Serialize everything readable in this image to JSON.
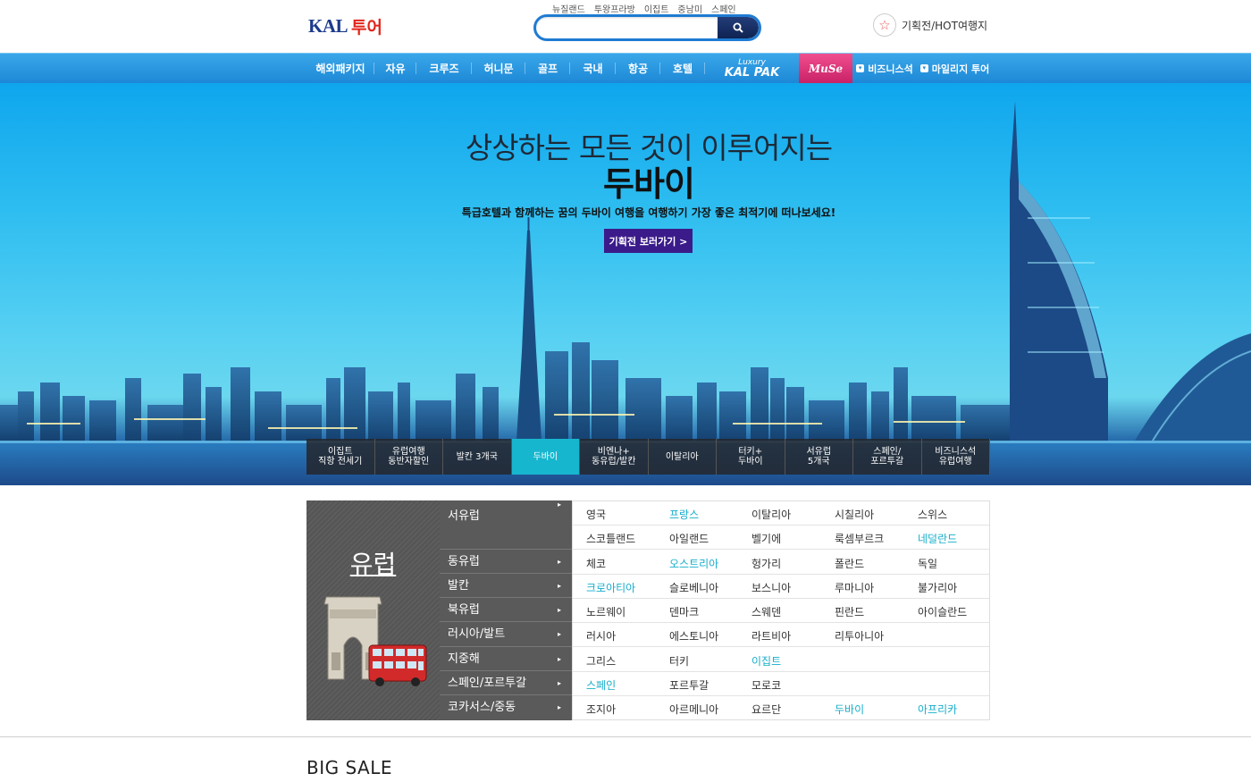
{
  "header": {
    "logo_kal": "KAL",
    "logo_tour": "투어",
    "quick_links": [
      "뉴질랜드",
      "투왕프라방",
      "이집트",
      "중남미",
      "스페인"
    ],
    "search_placeholder": "",
    "search_icon": "search-icon",
    "hot_link": "기획전/HOT여행지"
  },
  "nav": {
    "items": [
      "해외패키지",
      "자유",
      "크루즈",
      "허니문",
      "골프",
      "국내",
      "항공",
      "호텔"
    ],
    "luxury_small": "Luxury",
    "luxury_brand": "KAL PAK",
    "muse": "MuSe",
    "business": "비즈니스석",
    "mileage": "마일리지 투어"
  },
  "hero": {
    "headline": "상상하는 모든 것이 이루어지는",
    "destination": "두바이",
    "subtitle": "특급호텔과 함께하는 꿈의 두바이 여행을 여행하기 가장 좋은 최적기에 떠나보세요!",
    "cta": "기획전 보러가기 >",
    "tabs": [
      "이집트\n직항 전세기",
      "유럽여행\n동반자할인",
      "발칸 3개국",
      "두바이",
      "비엔나+\n동유럽/발칸",
      "이탈리아",
      "터키+\n두바이",
      "서유럽\n5개국",
      "스페인/\n포르투갈",
      "비즈니스석\n유럽여행"
    ],
    "active_tab": "두바이"
  },
  "region": {
    "name": "유럽",
    "menu": [
      "서유럽",
      "동유럽",
      "발칸",
      "북유럽",
      "러시아/발트",
      "지중해",
      "스페인/포르투갈",
      "코카서스/중동"
    ],
    "rows": [
      [
        "영국",
        "프랑스",
        "이탈리아",
        "시칠리아",
        "스위스"
      ],
      [
        "스코틀랜드",
        "아일랜드",
        "벨기에",
        "룩셈부르크",
        "네덜란드"
      ],
      [
        "체코",
        "오스트리아",
        "헝가리",
        "폴란드",
        "독일"
      ],
      [
        "크로아티아",
        "슬로베니아",
        "보스니아",
        "루마니아",
        "불가리아"
      ],
      [
        "노르웨이",
        "덴마크",
        "스웨덴",
        "핀란드",
        "아이슬란드"
      ],
      [
        "러시아",
        "에스토니아",
        "라트비아",
        "리투아니아",
        ""
      ],
      [
        "그리스",
        "터키",
        "이집트",
        "",
        ""
      ],
      [
        "스페인",
        "포르투갈",
        "모로코",
        "",
        ""
      ],
      [
        "조지아",
        "아르메니아",
        "요르단",
        "두바이",
        "아프리카"
      ]
    ],
    "highlighted": [
      "프랑스",
      "네덜란드",
      "오스트리아",
      "크로아티아",
      "이집트",
      "스페인",
      "두바이",
      "아프리카"
    ],
    "accent_color": "#16aecb"
  },
  "section": {
    "title": "BIG SALE"
  }
}
